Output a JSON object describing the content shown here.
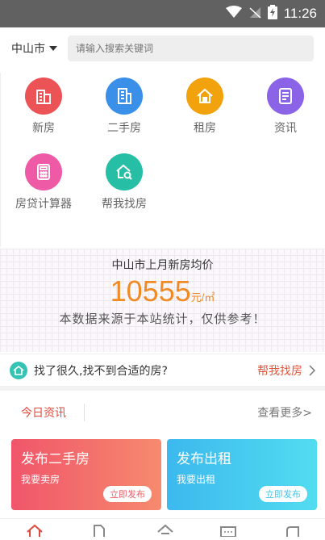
{
  "status_bar": {
    "time": "11:26"
  },
  "header": {
    "city": "中山市",
    "search_placeholder": "请输入搜索关键词"
  },
  "menu": [
    {
      "label": "新房",
      "icon": "building-icon",
      "color": "#ec5356"
    },
    {
      "label": "二手房",
      "icon": "apartment-icon",
      "color": "#3a8fe8"
    },
    {
      "label": "租房",
      "icon": "rent-house-icon",
      "color": "#f2a20c"
    },
    {
      "label": "资讯",
      "icon": "news-icon",
      "color": "#8a63e6"
    },
    {
      "label": "房贷计算器",
      "icon": "calculator-icon",
      "color": "#ef5aa6"
    },
    {
      "label": "帮我找房",
      "icon": "find-house-icon",
      "color": "#26bfa6"
    }
  ],
  "banner": {
    "title": "中山市上月新房均价",
    "price": "10555",
    "unit": "元/㎡",
    "note": "本数据来源于本站统计，仅供参考！"
  },
  "help": {
    "question": "找了很久,找不到合适的房?",
    "link": "帮我找房"
  },
  "news": {
    "today": "今日资讯",
    "more": "查看更多>"
  },
  "cards": [
    {
      "title": "发布二手房",
      "subtitle": "我要卖房",
      "button": "立即发布",
      "color": "#f05f6a"
    },
    {
      "title": "发布出租",
      "subtitle": "我要出租",
      "button": "立即发布",
      "color": "#3fc6ee"
    }
  ]
}
